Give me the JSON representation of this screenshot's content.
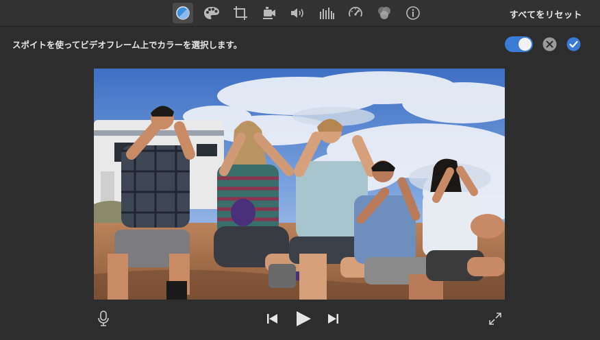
{
  "toolbar": {
    "tools": [
      {
        "name": "color-balance-icon",
        "active": true
      },
      {
        "name": "color-correction-icon",
        "active": false
      },
      {
        "name": "cropping-icon",
        "active": false
      },
      {
        "name": "stabilization-icon",
        "active": false
      },
      {
        "name": "volume-icon",
        "active": false
      },
      {
        "name": "noise-reduction-equalizer-icon",
        "active": false
      },
      {
        "name": "speed-icon",
        "active": false
      },
      {
        "name": "clip-filter-icon",
        "active": false
      },
      {
        "name": "info-icon",
        "active": false
      }
    ],
    "reset_all_label": "すべてをリセット"
  },
  "instruction_bar": {
    "text": "スポイトを使ってビデオフレーム上でカラーを選択します。",
    "toggle_on": true
  },
  "viewer": {
    "content": "video-frame"
  },
  "playback": {
    "icons": [
      "microphone-icon",
      "skip-back-icon",
      "play-icon",
      "skip-forward-icon",
      "fullscreen-icon"
    ]
  },
  "colors": {
    "accent": "#3a7bd5",
    "background": "#2d2d2d",
    "toolbar": "#323232",
    "text": "#e6e6e6"
  }
}
